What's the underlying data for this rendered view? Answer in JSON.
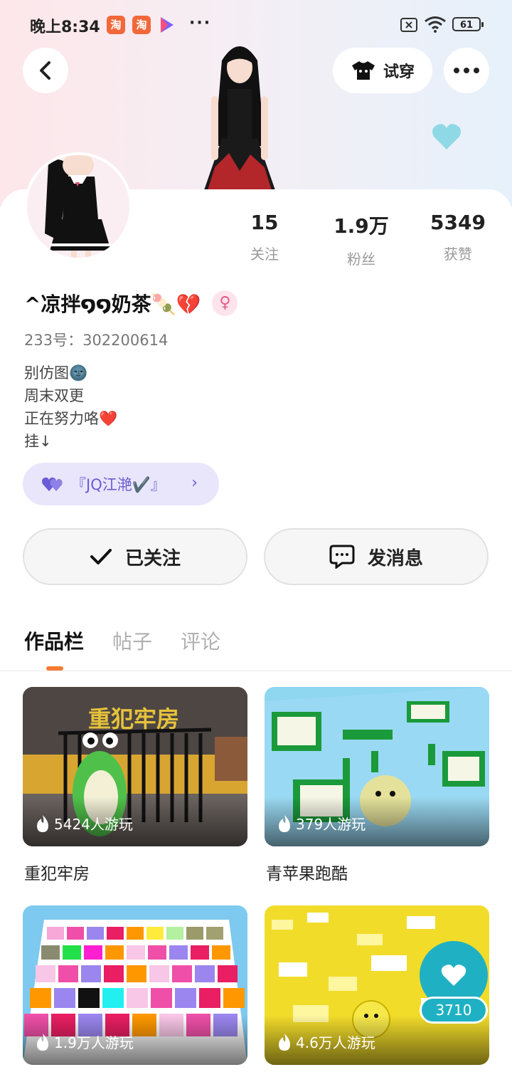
{
  "status_bar": {
    "time": "晚上8:34",
    "battery": "61"
  },
  "header": {
    "try_on_label": "试穿"
  },
  "profile": {
    "stats": [
      {
        "num": "15",
        "label": "关注"
      },
      {
        "num": "1.9万",
        "label": "粉丝"
      },
      {
        "num": "5349",
        "label": "获赞"
      }
    ],
    "name": "^凉拌໑໑奶茶🍡💔",
    "gender_symbol": "♀",
    "uid": "233号：302200614",
    "bio": [
      "别仿图🌚",
      "周末双更",
      "正在努力咯❤️",
      "挂↓"
    ],
    "tag_label": "『JQ江滟✔️』"
  },
  "actions": {
    "following_label": "已关注",
    "message_label": "发消息"
  },
  "tabs": [
    "作品栏",
    "帖子",
    "评论"
  ],
  "games": [
    {
      "plays": "5424人游玩",
      "title": "重犯牢房",
      "cover_text": "重犯牢房"
    },
    {
      "plays": "379人游玩",
      "title": "青苹果跑酷"
    },
    {
      "plays": "1.9万人游玩"
    },
    {
      "plays": "4.6万人游玩"
    }
  ],
  "fab": {
    "count": "3710"
  },
  "colors": {
    "accent": "#f47b34",
    "fab": "#1fb1c3",
    "tag_bg": "#e9e6fb"
  }
}
